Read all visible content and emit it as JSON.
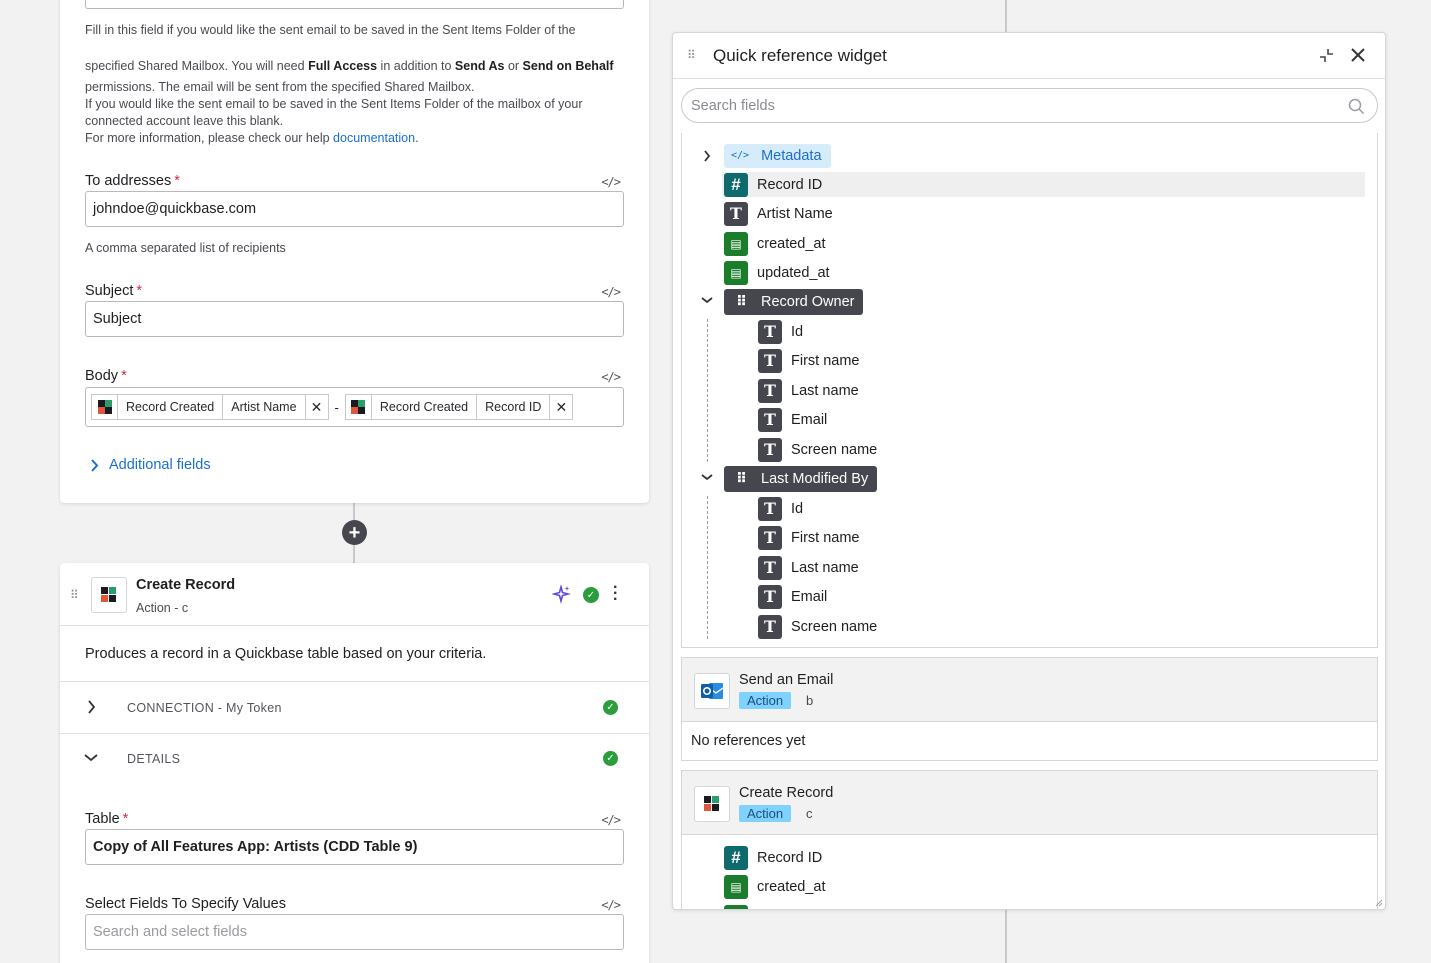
{
  "email_card": {
    "help_line1": "Fill in this field if you would like the sent email to be saved in the Sent Items Folder of the",
    "help_line2_a": "specified Shared Mailbox. You will need ",
    "help_line2_b1": "Full Access",
    "help_line2_c": " in addition to ",
    "help_line2_b2": "Send As",
    "help_line2_d": " or ",
    "help_line2_b3": "Send on Behalf",
    "help_line3": "permissions. The email will be sent from the specified Shared Mailbox.",
    "help_line4": "If you would like the sent email to be saved in the Sent Items Folder of the mailbox of your",
    "help_line5": "connected account leave this blank.",
    "help_line6_a": "For more information, please check our help ",
    "help_line6_link": "documentation",
    "help_line6_end": ".",
    "to_label": "To addresses",
    "required_mark": "*",
    "code_icon": "</>",
    "to_value": "johndoe@quickbase.com",
    "to_sub": "A comma separated list of recipients",
    "subject_label": "Subject",
    "subject_value": "Subject",
    "body_label": "Body",
    "body_pill1": [
      "Record Created",
      "Artist Name"
    ],
    "body_separator": "-",
    "body_pill2": [
      "Record Created",
      "Record ID"
    ],
    "remove_glyph": "✕",
    "additional_fields": "Additional fields"
  },
  "create_card": {
    "title": "Create Record",
    "subtitle": "Action - c",
    "description": "Produces a record in a Quickbase table based on your criteria.",
    "connection_label": "CONNECTION - My Token",
    "details_label": "DETAILS",
    "table_label": "Table",
    "table_value": "Copy of All Features App: Artists (CDD Table 9)",
    "select_fields_label": "Select Fields To Specify Values",
    "select_fields_placeholder": "Search and select fields"
  },
  "widget": {
    "title": "Quick reference widget",
    "search_placeholder": "Search fields",
    "metadata_label": "Metadata",
    "fields": [
      {
        "icon": "hash",
        "label": "Record ID"
      },
      {
        "icon": "T",
        "label": "Artist Name"
      },
      {
        "icon": "datetime",
        "label": "created_at"
      },
      {
        "icon": "datetime",
        "label": "updated_at"
      }
    ],
    "record_owner_label": "Record Owner",
    "record_owner_fields": [
      "Id",
      "First name",
      "Last name",
      "Email",
      "Screen name"
    ],
    "last_modified_label": "Last Modified By",
    "last_modified_fields": [
      "Id",
      "First name",
      "Last name",
      "Email",
      "Screen name"
    ],
    "send_email_step": {
      "title": "Send an Email",
      "badge": "Action",
      "letter": "b",
      "empty_text": "No references yet"
    },
    "create_record_step": {
      "title": "Create Record",
      "badge": "Action",
      "letter": "c",
      "fields": [
        "Record ID",
        "created_at"
      ]
    }
  },
  "colors": {
    "accent_link": "#1a6fd1",
    "success": "#2a9d3c",
    "required": "#d6293e",
    "action_badge": "#7fd1ff"
  }
}
